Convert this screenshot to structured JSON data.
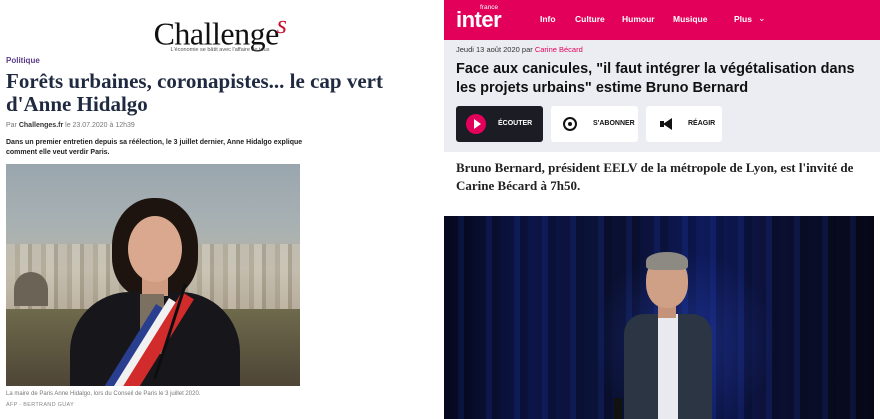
{
  "left": {
    "logo": {
      "text": "Challenge",
      "s": "s",
      "tagline": "L'économie se bâtit avec l'affaire de tous"
    },
    "rubric": "Politique",
    "headline": "Forêts urbaines, coronapistes... le cap vert d'Anne Hidalgo",
    "byline": {
      "prefix": "Par ",
      "source": "Challenges.fr",
      "date": " le 23.07.2020 à 12h39"
    },
    "chapo": "Dans un premier entretien depuis sa réélection, le 3 juillet dernier, Anne Hidalgo explique comment elle veut verdir Paris.",
    "caption": "La maire de Paris Anne Hidalgo, lors du Conseil de Paris le 3 juillet 2020.",
    "credit": "AFP - BERTRAND GUAY"
  },
  "right": {
    "brand": {
      "small": "france",
      "big": "inter"
    },
    "nav": [
      "Info",
      "Culture",
      "Humour",
      "Musique",
      "Plus"
    ],
    "date": "Jeudi 13 août 2020",
    "by": " par ",
    "author": "Carine Bécard",
    "title": "Face aux canicules, \"il faut intégrer la végétalisation dans les projets urbains\" estime Bruno Bernard",
    "buttons": {
      "listen": "ÉCOUTER",
      "subscribe": "S'ABONNER",
      "react": "RÉAGIR"
    },
    "chapo": "Bruno Bernard, président EELV de la métropole de Lyon, est l'invité de Carine Bécard à 7h50."
  },
  "colors": {
    "inter_pink": "#e2005a",
    "challenges_red": "#c8102e",
    "rubric_purple": "#5b3c8a"
  },
  "icons": [
    "play-icon",
    "subscribe-icon",
    "megaphone-icon",
    "chevron-down-icon"
  ]
}
